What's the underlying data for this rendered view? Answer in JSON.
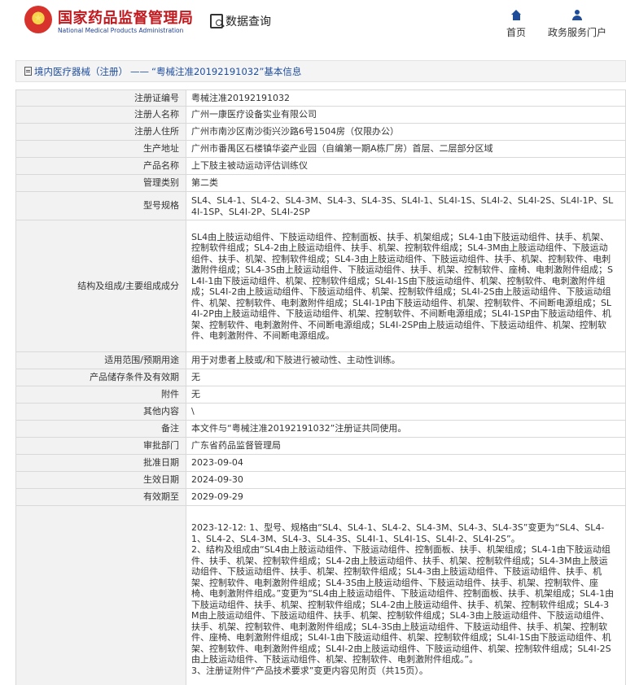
{
  "header": {
    "site_name_cn": "国家药品监督管理局",
    "site_name_en": "National Medical Products Administration",
    "data_query_label": "数据查询",
    "nav_home_label": "首页",
    "nav_services_label": "政务服务门户"
  },
  "breadcrumb": {
    "category_link": "境内医疗器械（注册）",
    "separator": "——",
    "detail_title": "“粤械注准20192191032”基本信息"
  },
  "rows": [
    {
      "label": "注册证编号",
      "value": "粤械注准20192191032"
    },
    {
      "label": "注册人名称",
      "value": "广州一康医疗设备实业有限公司"
    },
    {
      "label": "注册人住所",
      "value": "广州市南沙区南沙街兴沙路6号1504房（仅限办公）"
    },
    {
      "label": "生产地址",
      "value": "广州市番禺区石楼镇华姿产业园（自编第一期A栋厂房）首层、二层部分区域"
    },
    {
      "label": "产品名称",
      "value": "上下肢主被动运动评估训练仪"
    },
    {
      "label": "管理类别",
      "value": "第二类"
    },
    {
      "label": "型号规格",
      "value": "SL4、SL4-1、SL4-2、SL4-3M、SL4-3、SL4-3S、SL4I-1、SL4I-1S、SL4I-2、SL4I-2S、SL4I-1P、SL4I-1SP、SL4I-2P、SL4I-2SP"
    },
    {
      "label": "结构及组成/主要组成成分",
      "value": "SL4由上肢运动组件、下肢运动组件、控制面板、扶手、机架组成；SL4-1由下肢运动组件、扶手、机架、控制软件组成；SL4-2由上肢运动组件、扶手、机架、控制软件组成；SL4-3M由上肢运动组件、下肢运动组件、扶手、机架、控制软件组成；SL4-3由上肢运动组件、下肢运动组件、扶手、机架、控制软件、电刺激附件组成；SL4-3S由上肢运动组件、下肢运动组件、扶手、机架、控制软件、座椅、电刺激附件组成；SL4I-1由下肢运动组件、机架、控制软件组成；SL4I-1S由下肢运动组件、机架、控制软件、电刺激附件组成；SL4I-2由上肢运动组件、下肢运动组件、机架、控制软件组成；SL4I-2S由上肢运动组件、下肢运动组件、机架、控制软件、电刺激附件组成；SL4I-1P由下肢运动组件、机架、控制软件、不间断电源组成；SL4I-2P由上肢运动组件、下肢运动组件、机架、控制软件、不间断电源组成；SL4I-1SP由下肢运动组件、机架、控制软件、电刺激附件、不间断电源组成；SL4I-2SP由上肢运动组件、下肢运动组件、机架、控制软件、电刺激附件、不间断电源组成。"
    },
    {
      "label": "适用范围/预期用途",
      "value": "用于对患者上肢或/和下肢进行被动性、主动性训练。"
    },
    {
      "label": "产品储存条件及有效期",
      "value": "无"
    },
    {
      "label": "附件",
      "value": "无"
    },
    {
      "label": "其他内容",
      "value": "\\"
    },
    {
      "label": "备注",
      "value": "本文件与“粤械注准20192191032”注册证共同使用。"
    },
    {
      "label": "审批部门",
      "value": "广东省药品监督管理局"
    },
    {
      "label": "批准日期",
      "value": "2023-09-04"
    },
    {
      "label": "生效日期",
      "value": "2024-09-30"
    },
    {
      "label": "有效期至",
      "value": "2029-09-29"
    }
  ],
  "change_history": {
    "label": "",
    "lines": [
      "2023-12-12: 1、型号、规格由“SL4、SL4-1、SL4-2、SL4-3M、SL4-3、SL4-3S”变更为“SL4、SL4-1、SL4-2、SL4-3M、SL4-3、SL4-3S、SL4I-1、SL4I-1S、SL4I-2、SL4I-2S”。",
      "2、结构及组成由“SL4由上肢运动组件、下肢运动组件、控制面板、扶手、机架组成；SL4-1由下肢运动组件、扶手、机架、控制软件组成；SL4-2由上肢运动组件、扶手、机架、控制软件组成；SL4-3M由上肢运动组件、下肢运动组件、扶手、机架、控制软件组成；SL4-3由上肢运动组件、下肢运动组件、扶手、机架、控制软件、电刺激附件组成；SL4-3S由上肢运动组件、下肢运动组件、扶手、机架、控制软件、座椅、电刺激附件组成。”变更为“SL4由上肢运动组件、下肢运动组件、控制面板、扶手、机架组成；SL4-1由下肢运动组件、扶手、机架、控制软件组成；SL4-2由上肢运动组件、扶手、机架、控制软件组成；SL4-3M由上肢运动组件、下肢运动组件、扶手、机架、控制软件组成；SL4-3由上肢运动组件、下肢运动组件、扶手、机架、控制软件、电刺激附件组成；SL4-3S由上肢运动组件、下肢运动组件、扶手、机架、控制软件、座椅、电刺激附件组成；SL4I-1由下肢运动组件、机架、控制软件组成；SL4I-1S由下肢运动组件、机架、控制软件、电刺激附件组成；SL4I-2由上肢运动组件、下肢运动组件、机架、控制软件组成；SL4I-2S由上肢运动组件、下肢运动组件、机架、控制软件、电刺激附件组成。”。",
      "3、注册证附件“产品技术要求”变更内容见附页（共15页）。"
    ]
  },
  "colors": {
    "brand_red": "#c2191f",
    "link_blue": "#1f4fa0",
    "label_bg": "#f2f2f2",
    "border": "#d9d9d9"
  },
  "icons": [
    "emblem-logo",
    "search-doc-icon",
    "home-icon",
    "user-icon",
    "doc-icon"
  ]
}
